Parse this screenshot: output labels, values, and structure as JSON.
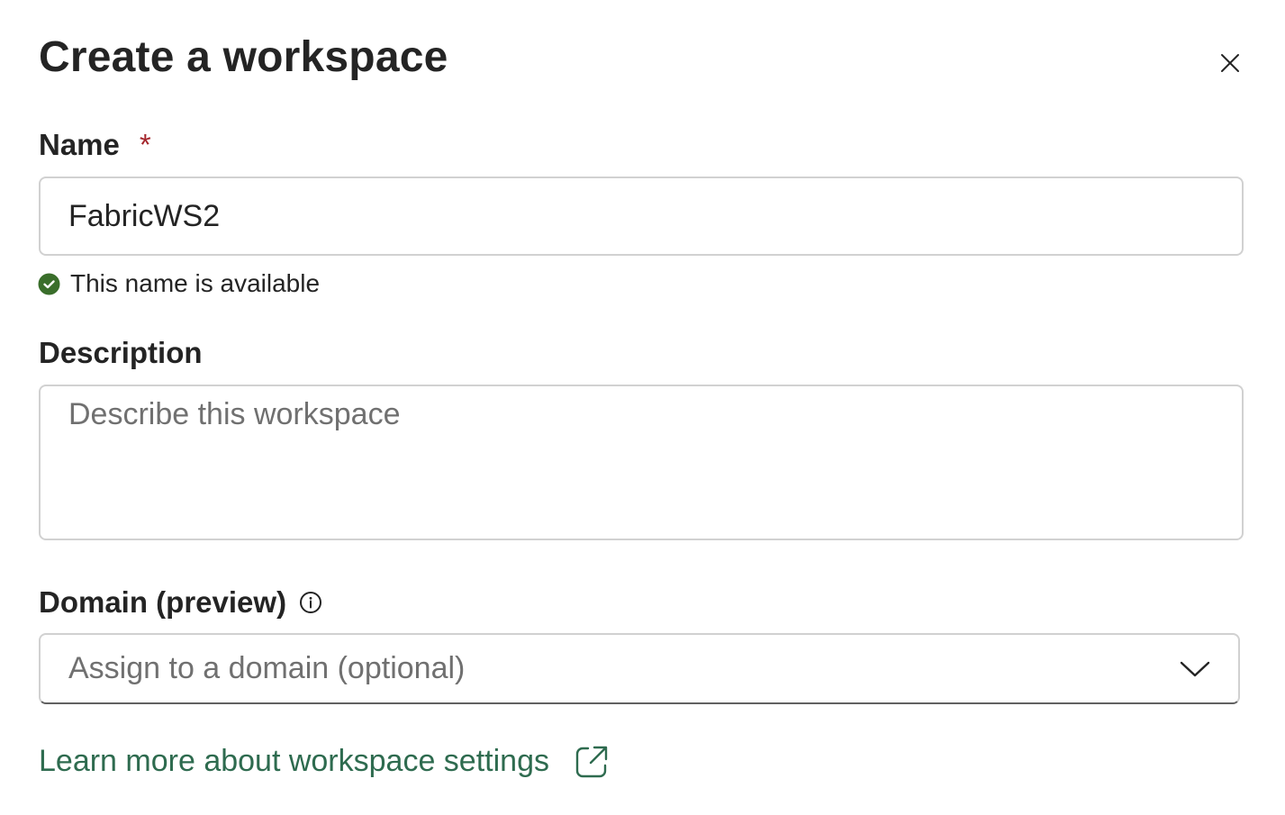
{
  "dialog": {
    "title": "Create a workspace",
    "close_icon": "close-icon"
  },
  "name_field": {
    "label": "Name",
    "required_marker": "*",
    "value": "FabricWS2",
    "validation_message": "This name is available",
    "validation_icon": "check-circle-icon",
    "validation_color": "#3a6e2b"
  },
  "description_field": {
    "label": "Description",
    "placeholder": "Describe this workspace",
    "value": ""
  },
  "domain_field": {
    "label": "Domain (preview)",
    "info_icon": "info-icon",
    "placeholder": "Assign to a domain (optional)",
    "chevron_icon": "chevron-down-icon"
  },
  "learn_more": {
    "text": "Learn more about workspace settings",
    "icon": "external-link-icon",
    "color": "#2e6b4f"
  }
}
